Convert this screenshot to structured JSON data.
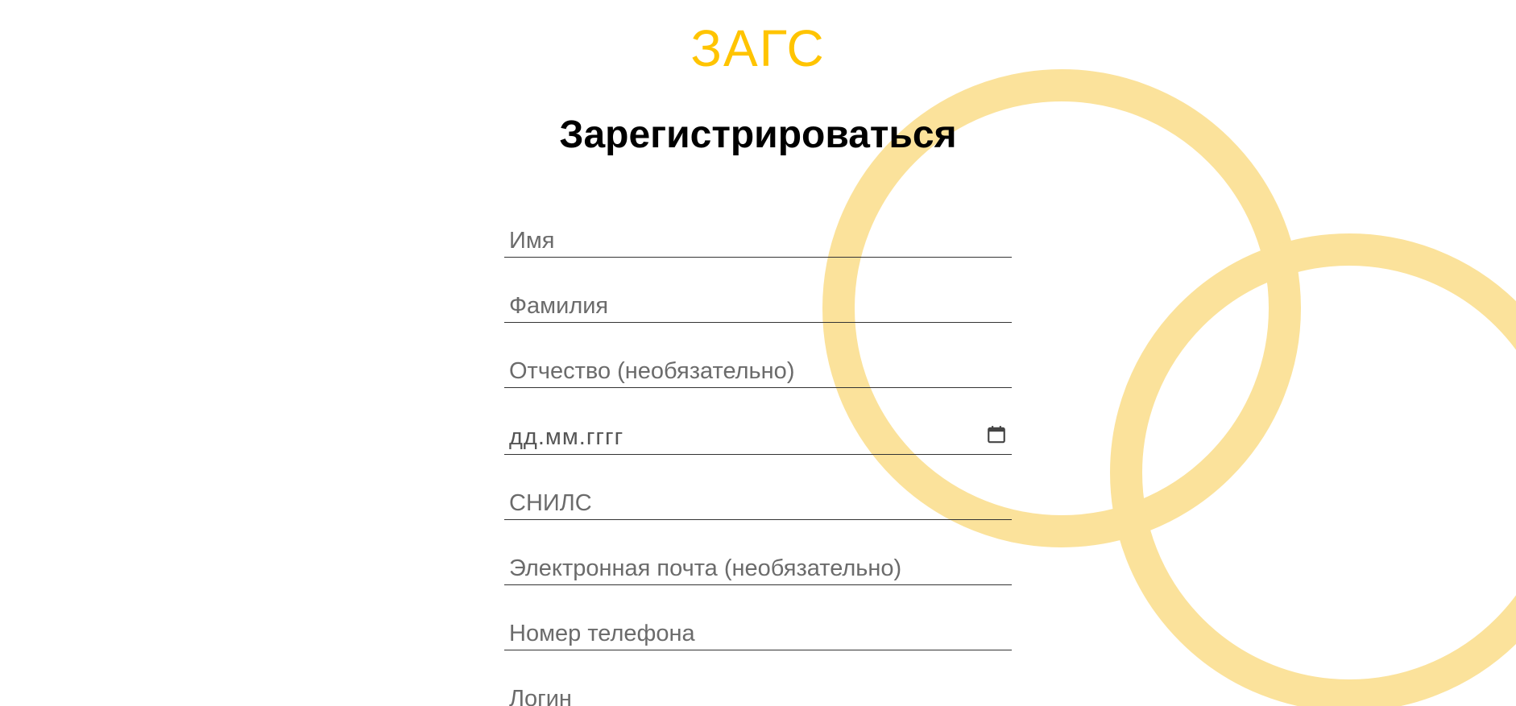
{
  "brand": {
    "logo_text": "ЗАГС",
    "accent_color": "#ffc400",
    "ring_color": "#fbe29b"
  },
  "header": {
    "title": "Зарегистрироваться"
  },
  "form": {
    "first_name_placeholder": "Имя",
    "last_name_placeholder": "Фамилия",
    "patronymic_placeholder": "Отчество (необязательно)",
    "birthdate_placeholder": "дд.мм.гггг",
    "birthdate_icon": "calendar-icon",
    "snils_placeholder": "СНИЛС",
    "email_placeholder": "Электронная почта (необязательно)",
    "phone_placeholder": "Номер телефона",
    "login_placeholder": "Логин"
  }
}
